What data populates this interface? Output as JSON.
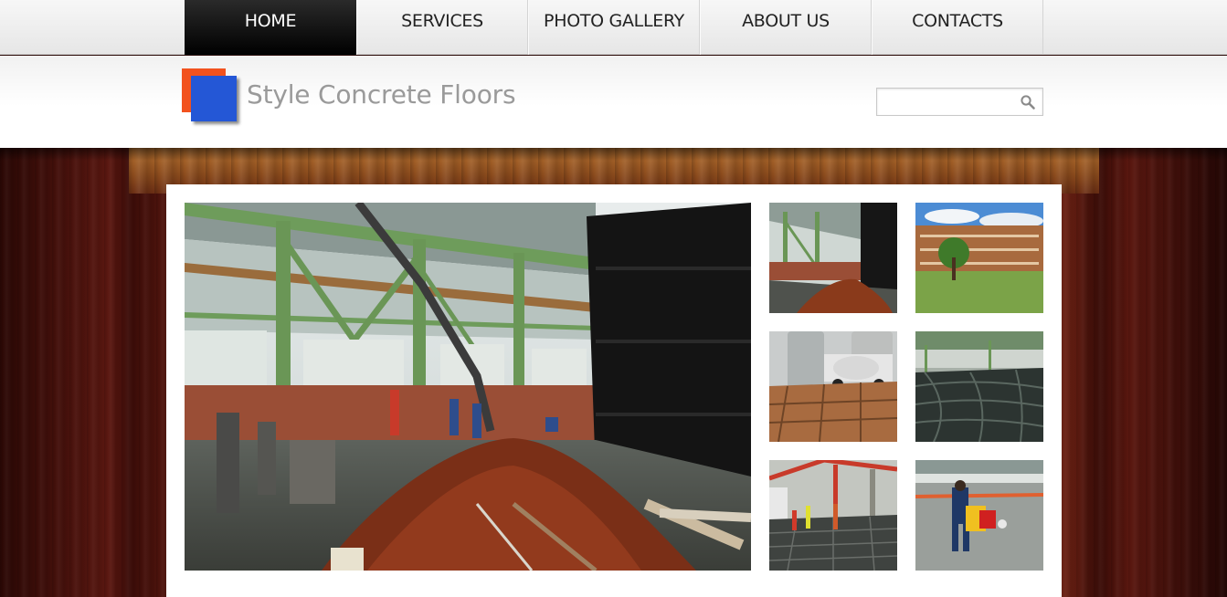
{
  "nav": {
    "items": [
      {
        "label": "HOME",
        "active": true
      },
      {
        "label": "SERVICES",
        "active": false
      },
      {
        "label": "PHOTO GALLERY",
        "active": false
      },
      {
        "label": "ABOUT US",
        "active": false
      },
      {
        "label": "CONTACTS",
        "active": false
      }
    ]
  },
  "header": {
    "site_name": "Style Concrete Floors",
    "logo_colors": {
      "back": "#f2521e",
      "front": "#2457d6"
    },
    "search": {
      "value": "",
      "placeholder": "",
      "icon": "search-icon"
    }
  },
  "gallery": {
    "hero": {
      "description_icon": "photo"
    },
    "thumbnails": [
      {
        "icon": "photo"
      },
      {
        "icon": "photo"
      },
      {
        "icon": "photo"
      },
      {
        "icon": "photo"
      },
      {
        "icon": "photo"
      },
      {
        "icon": "photo"
      }
    ]
  },
  "colors": {
    "nav_active_bg": "#000000",
    "nav_bg": "#ececec",
    "accent_orange": "#f2521e",
    "accent_blue": "#2457d6",
    "wood_dark": "#3b0d08"
  }
}
